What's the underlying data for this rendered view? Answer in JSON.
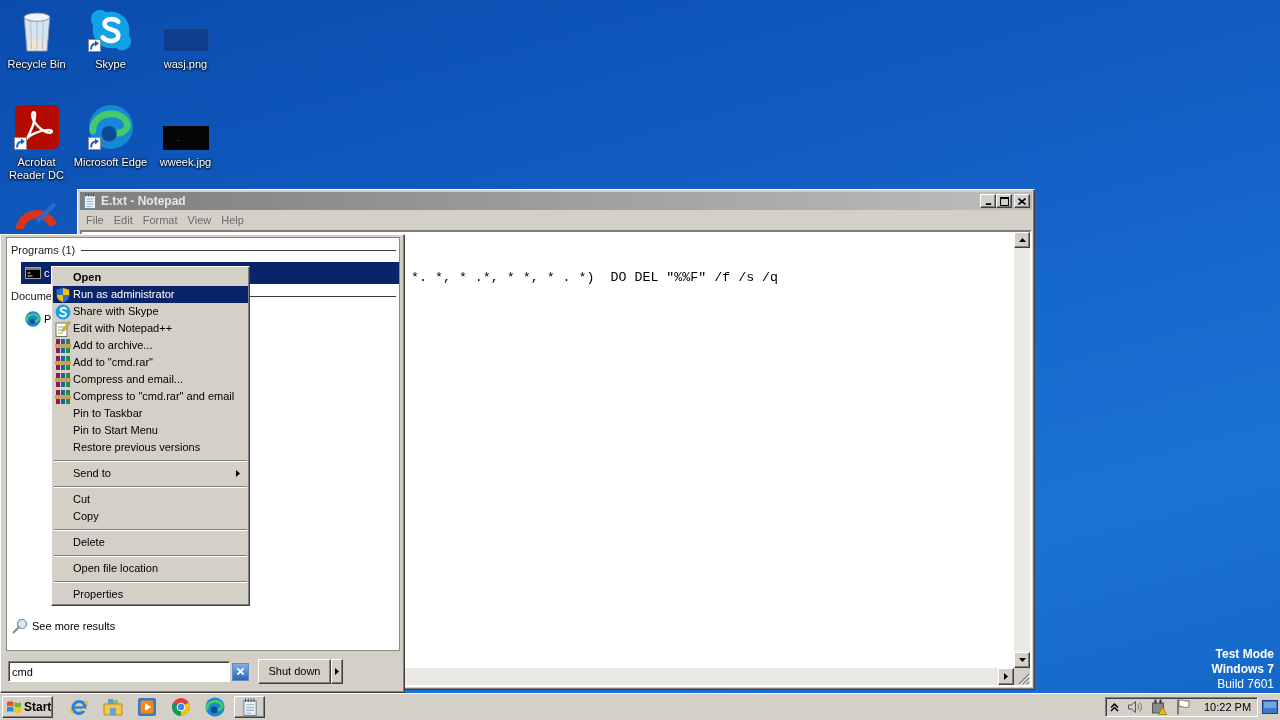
{
  "desktop": {
    "icons": [
      {
        "label": "Recycle Bin",
        "kind": "bin",
        "shortcut": false
      },
      {
        "label": "Skype",
        "kind": "skype",
        "shortcut": true
      },
      {
        "label": "wasj.png",
        "kind": "blank-image",
        "shortcut": false
      },
      {
        "label": "Acrobat Reader DC",
        "kind": "acrobat",
        "shortcut": true
      },
      {
        "label": "Microsoft Edge",
        "kind": "edge",
        "shortcut": true
      },
      {
        "label": "wweek.jpg",
        "kind": "dark-image",
        "shortcut": false
      },
      {
        "kind": "cleaner"
      }
    ],
    "test_mode": [
      {
        "text": "Test Mode",
        "bold": true
      },
      {
        "text": "Windows 7",
        "bold": true
      },
      {
        "text": "Build 7601",
        "bold": false
      }
    ]
  },
  "notepad": {
    "title": "E.txt - Notepad",
    "menu": [
      "File",
      "Edit",
      "Format",
      "View",
      "Help"
    ],
    "text": "*. *, * .*, * *, * . *)  DO DEL \"%%F\" /f /s /q"
  },
  "start_menu": {
    "sections": [
      {
        "heading": "Programs (1)",
        "items": [
          {
            "label": "c",
            "kind": "cmd",
            "selected": true
          }
        ]
      },
      {
        "heading": "Docume",
        "items": [
          {
            "label": "P",
            "kind": "edge",
            "selected": false
          }
        ]
      }
    ],
    "see_more": "See more results",
    "search": {
      "value": "cmd"
    },
    "shutdown": "Shut down"
  },
  "context_menu": {
    "groups": [
      [
        {
          "label": "Open",
          "kind": "default",
          "selected": false
        },
        {
          "label": "Run as administrator",
          "kind": "shield",
          "selected": true
        },
        {
          "label": "Share with Skype",
          "kind": "skype",
          "selected": false
        },
        {
          "label": "Edit with Notepad++",
          "kind": "editor",
          "selected": false
        },
        {
          "label": "Add to archive...",
          "kind": "archive",
          "selected": false
        },
        {
          "label": "Add to \"cmd.rar\"",
          "kind": "archive",
          "selected": false
        },
        {
          "label": "Compress and email...",
          "kind": "archive",
          "selected": false
        },
        {
          "label": "Compress to \"cmd.rar\" and email",
          "kind": "archive",
          "selected": false
        },
        {
          "label": "Pin to Taskbar",
          "kind": "plain",
          "selected": false
        },
        {
          "label": "Pin to Start Menu",
          "kind": "plain",
          "selected": false
        },
        {
          "label": "Restore previous versions",
          "kind": "plain",
          "selected": false
        }
      ],
      [
        {
          "label": "Send to",
          "kind": "submenu",
          "selected": false
        }
      ],
      [
        {
          "label": "Cut",
          "kind": "plain",
          "selected": false
        },
        {
          "label": "Copy",
          "kind": "plain",
          "selected": false
        }
      ],
      [
        {
          "label": "Delete",
          "kind": "plain",
          "selected": false
        }
      ],
      [
        {
          "label": "Open file location",
          "kind": "plain",
          "selected": false
        }
      ],
      [
        {
          "label": "Properties",
          "kind": "plain",
          "selected": false
        }
      ]
    ]
  },
  "taskbar": {
    "start": "Start",
    "quick_launch": [
      {
        "kind": "ie"
      },
      {
        "kind": "folder"
      },
      {
        "kind": "media"
      },
      {
        "kind": "chrome"
      },
      {
        "kind": "edge"
      }
    ],
    "windows": [
      {
        "kind": "notepad"
      }
    ],
    "tray": [
      {
        "kind": "chevron"
      },
      {
        "kind": "speaker"
      },
      {
        "kind": "network"
      },
      {
        "kind": "flag"
      }
    ],
    "clock": "10:22 PM"
  }
}
